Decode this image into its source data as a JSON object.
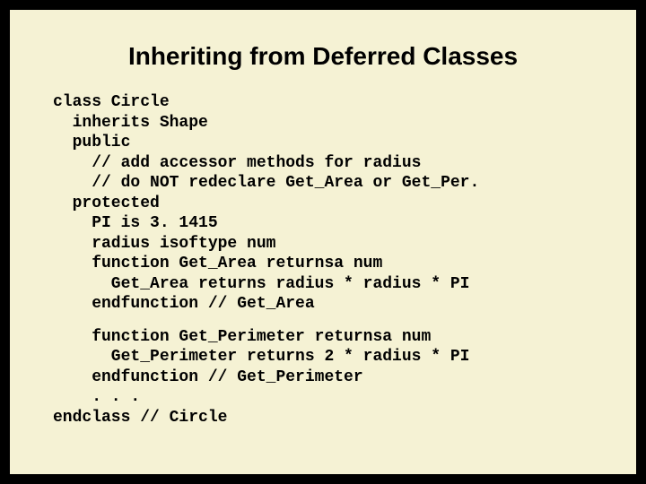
{
  "title": "Inheriting from Deferred Classes",
  "code1": "class Circle\n  inherits Shape\n  public\n    // add accessor methods for radius\n    // do NOT redeclare Get_Area or Get_Per.\n  protected\n    PI is 3. 1415\n    radius isoftype num\n    function Get_Area returnsa num\n      Get_Area returns radius * radius * PI\n    endfunction // Get_Area",
  "code2": "    function Get_Perimeter returnsa num\n      Get_Perimeter returns 2 * radius * PI\n    endfunction // Get_Perimeter\n    . . .\nendclass // Circle"
}
